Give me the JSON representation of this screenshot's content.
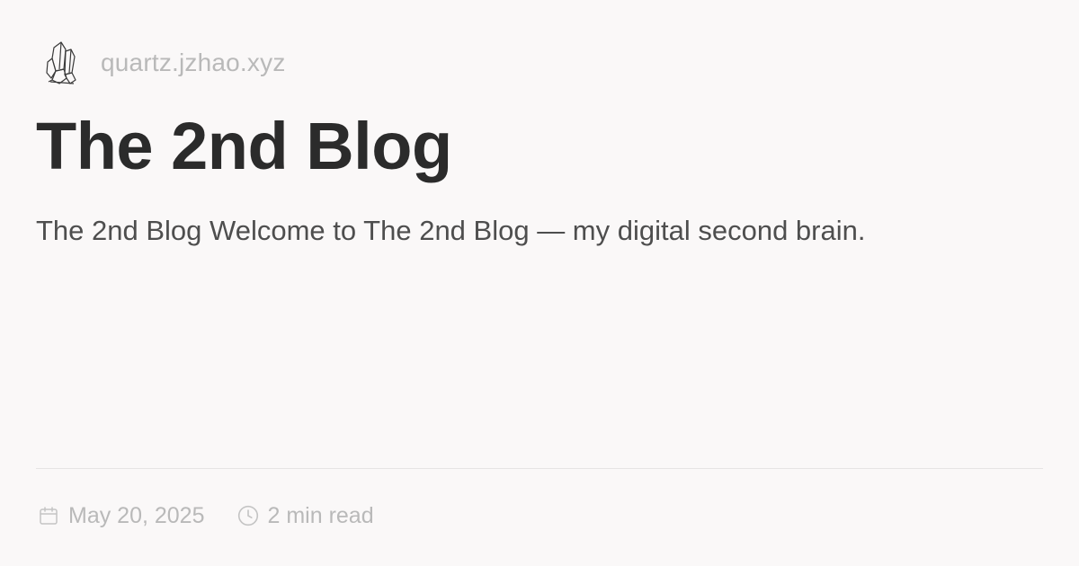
{
  "site": {
    "name": "quartz.jzhao.xyz",
    "logo_icon": "crystal-icon"
  },
  "article": {
    "title": "The 2nd Blog",
    "description": "The 2nd Blog Welcome to The 2nd Blog — my digital second brain."
  },
  "meta": {
    "date": "May 20, 2025",
    "date_icon": "calendar-icon",
    "reading_time": "2 min read",
    "reading_time_icon": "clock-icon"
  },
  "colors": {
    "background": "#faf8f8",
    "title": "#2b2b2b",
    "description": "#4e4e4e",
    "muted": "#b9b9b9",
    "divider": "#e6e4e4"
  }
}
